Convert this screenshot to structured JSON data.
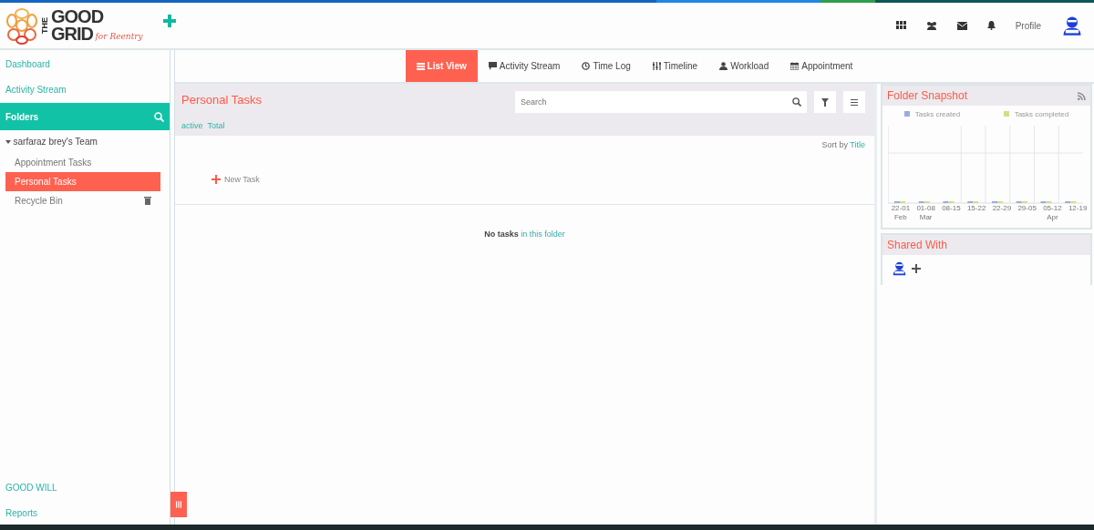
{
  "logo": {
    "the": "THE",
    "good": "GOOD",
    "grid": "GRID",
    "tagline": "for Reentry"
  },
  "header": {
    "profile_label": "Profile"
  },
  "sidebar": {
    "top_items": [
      {
        "label": "Dashboard"
      },
      {
        "label": "Activity Stream"
      }
    ],
    "folders_label": "Folders",
    "tree": [
      {
        "label": "sarfaraz brey's Team",
        "expanded": true,
        "children": [
          {
            "label": "Appointment Tasks",
            "selected": false,
            "kind": "folder"
          },
          {
            "label": "Personal Tasks",
            "selected": true,
            "kind": "folder"
          },
          {
            "label": "Recycle Bin",
            "selected": false,
            "kind": "trash"
          }
        ]
      }
    ],
    "bottom_items": [
      {
        "label": "GOOD WILL"
      },
      {
        "label": "Reports"
      }
    ]
  },
  "tabs": [
    {
      "label": "List View",
      "selected": true,
      "kind": "list"
    },
    {
      "label": "Activity Stream",
      "selected": false,
      "kind": "comment"
    },
    {
      "label": "Time Log",
      "selected": false,
      "kind": "clock"
    },
    {
      "label": "Timeline",
      "selected": false,
      "kind": "sliders"
    },
    {
      "label": "Workload",
      "selected": false,
      "kind": "user"
    },
    {
      "label": "Appointment",
      "selected": false,
      "kind": "calendar"
    }
  ],
  "task_panel": {
    "title": "Personal Tasks",
    "filter_active": "active",
    "filter_total": "Total",
    "search": {
      "placeholder": "Search"
    },
    "sort_prefix": "Sort by",
    "sort_field": "Title",
    "new_task": "New Task",
    "empty_bold": "No tasks",
    "empty_rest": "in this folder"
  },
  "folder_snapshot": {
    "title": "Folder Snapshot",
    "legend": [
      {
        "label": "Tasks created",
        "color": "#9aaedb"
      },
      {
        "label": "Tasks completed",
        "color": "#cfe08a"
      }
    ],
    "x_labels": [
      {
        "range": "22-01",
        "month": "Feb"
      },
      {
        "range": "01-08",
        "month": "Mar"
      },
      {
        "range": "08-15"
      },
      {
        "range": "15-22"
      },
      {
        "range": "22-29"
      },
      {
        "range": "29-05"
      },
      {
        "range": "05-12",
        "month": "Apr"
      },
      {
        "range": "12-19"
      }
    ]
  },
  "shared_with": {
    "title": "Shared With"
  }
}
